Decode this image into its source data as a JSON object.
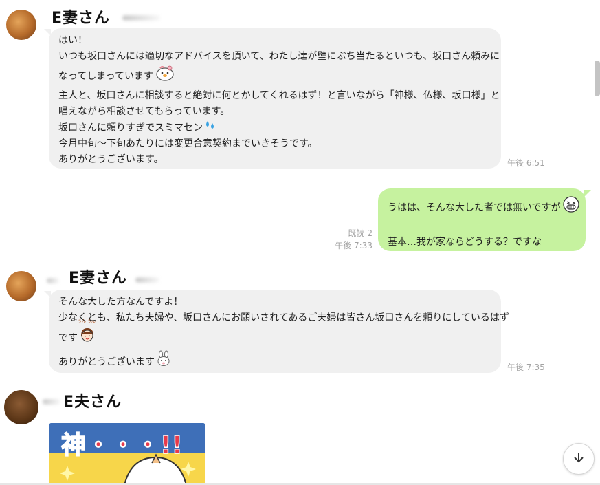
{
  "messages": [
    {
      "sender": "E妻さん",
      "direction": "incoming",
      "lines": [
        "はい！",
        "いつも坂口さんには適切なアドバイスを頂いて、わたし達が壁にぶち当たるといつも、坂口さん頼みに",
        "なってしまっています",
        "主人と、坂口さんに相談すると絶対に何とかしてくれるはず！と言いながら「神様、仏様、坂口様」と",
        "唱えながら相談させてもらっています。",
        "坂口さんに頼りすぎでスミマセン",
        "今月中旬〜下旬あたりには変更合意契約までいきそうです。",
        "ありがとうございます。"
      ],
      "time": "午後 6:51"
    },
    {
      "direction": "outgoing",
      "lines": [
        "うはは、そんな大した者では無いですが",
        "基本…我が家ならどうする？ですな"
      ],
      "read": "既読 2",
      "time": "午後 7:33"
    },
    {
      "sender": "E妻さん",
      "direction": "incoming",
      "lines": [
        "そんな大した方なんですよ！",
        "少なくとも、私たち夫婦や、坂口さんにお願いされてあるご夫婦は皆さん坂口さんを頼りにしているはず",
        "です",
        "ありがとうございます"
      ],
      "time": "午後 7:35"
    },
    {
      "sender": "E夫さん",
      "direction": "incoming",
      "sticker_text": "神・・・!!"
    }
  ],
  "emoji_small": "うん うん",
  "icons": {
    "scroll_down": "arrow-down-icon"
  },
  "colors": {
    "incoming_bubble": "#f0f0f0",
    "outgoing_bubble": "#c6f29f",
    "timestamp": "#a3a3a3"
  }
}
